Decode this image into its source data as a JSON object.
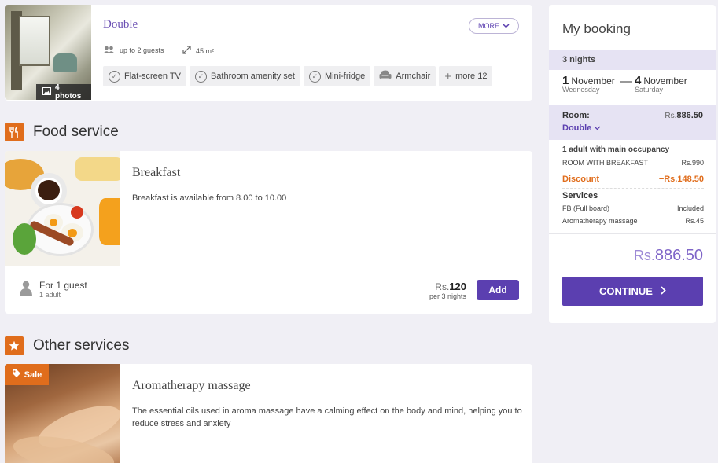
{
  "room": {
    "photos_badge": "4 photos",
    "title": "Double",
    "more_label": "MORE",
    "guests": "up to 2 guests",
    "area": "45 m²",
    "amenities": [
      "Flat-screen TV",
      "Bathroom amenity set",
      "Mini-fridge",
      "Armchair"
    ],
    "more_amenities": "more 12"
  },
  "food_section": {
    "title": "Food service",
    "icon": "fork-knife-icon"
  },
  "breakfast": {
    "title": "Breakfast",
    "description": "Breakfast is available from 8.00 to 10.00",
    "guest_label": "For 1 guest",
    "guest_sub": "1 adult",
    "price_currency": "Rs.",
    "price_amount": "120",
    "price_per": "per 3 nights",
    "add_label": "Add"
  },
  "other_section": {
    "title": "Other services",
    "icon": "star-icon"
  },
  "aroma": {
    "sale_label": "Sale",
    "title": "Aromatherapy massage",
    "description": "The essential oils used in aroma massage have a calming effect on the body and mind, helping you to reduce stress and anxiety"
  },
  "booking": {
    "title": "My booking",
    "nights": "3 nights",
    "checkin_day": "1",
    "checkin_month": "November",
    "checkin_weekday": "Wednesday",
    "dash": "—",
    "checkout_day": "4",
    "checkout_month": "November",
    "checkout_weekday": "Saturday",
    "room_label": "Room:",
    "room_price_currency": "Rs.",
    "room_price_amount": "886.50",
    "room_type": "Double",
    "occupancy_bold": "1 adult",
    "occupancy_rest": " with main occupancy",
    "rate_name": "ROOM WITH BREAKFAST",
    "rate_price": "Rs.990",
    "discount_label": "Discount",
    "discount_value": "−Rs.148.50",
    "services_label": "Services",
    "service1_name": "FB (Full board)",
    "service1_value": "Included",
    "service2_name": "Aromatherapy massage",
    "service2_value": "Rs.45",
    "total_currency": "Rs.",
    "total_amount": "886.50",
    "continue_label": "CONTINUE"
  },
  "colors": {
    "accent": "#5b3fb0",
    "orange": "#e06d1c",
    "background": "#f0eff5"
  }
}
